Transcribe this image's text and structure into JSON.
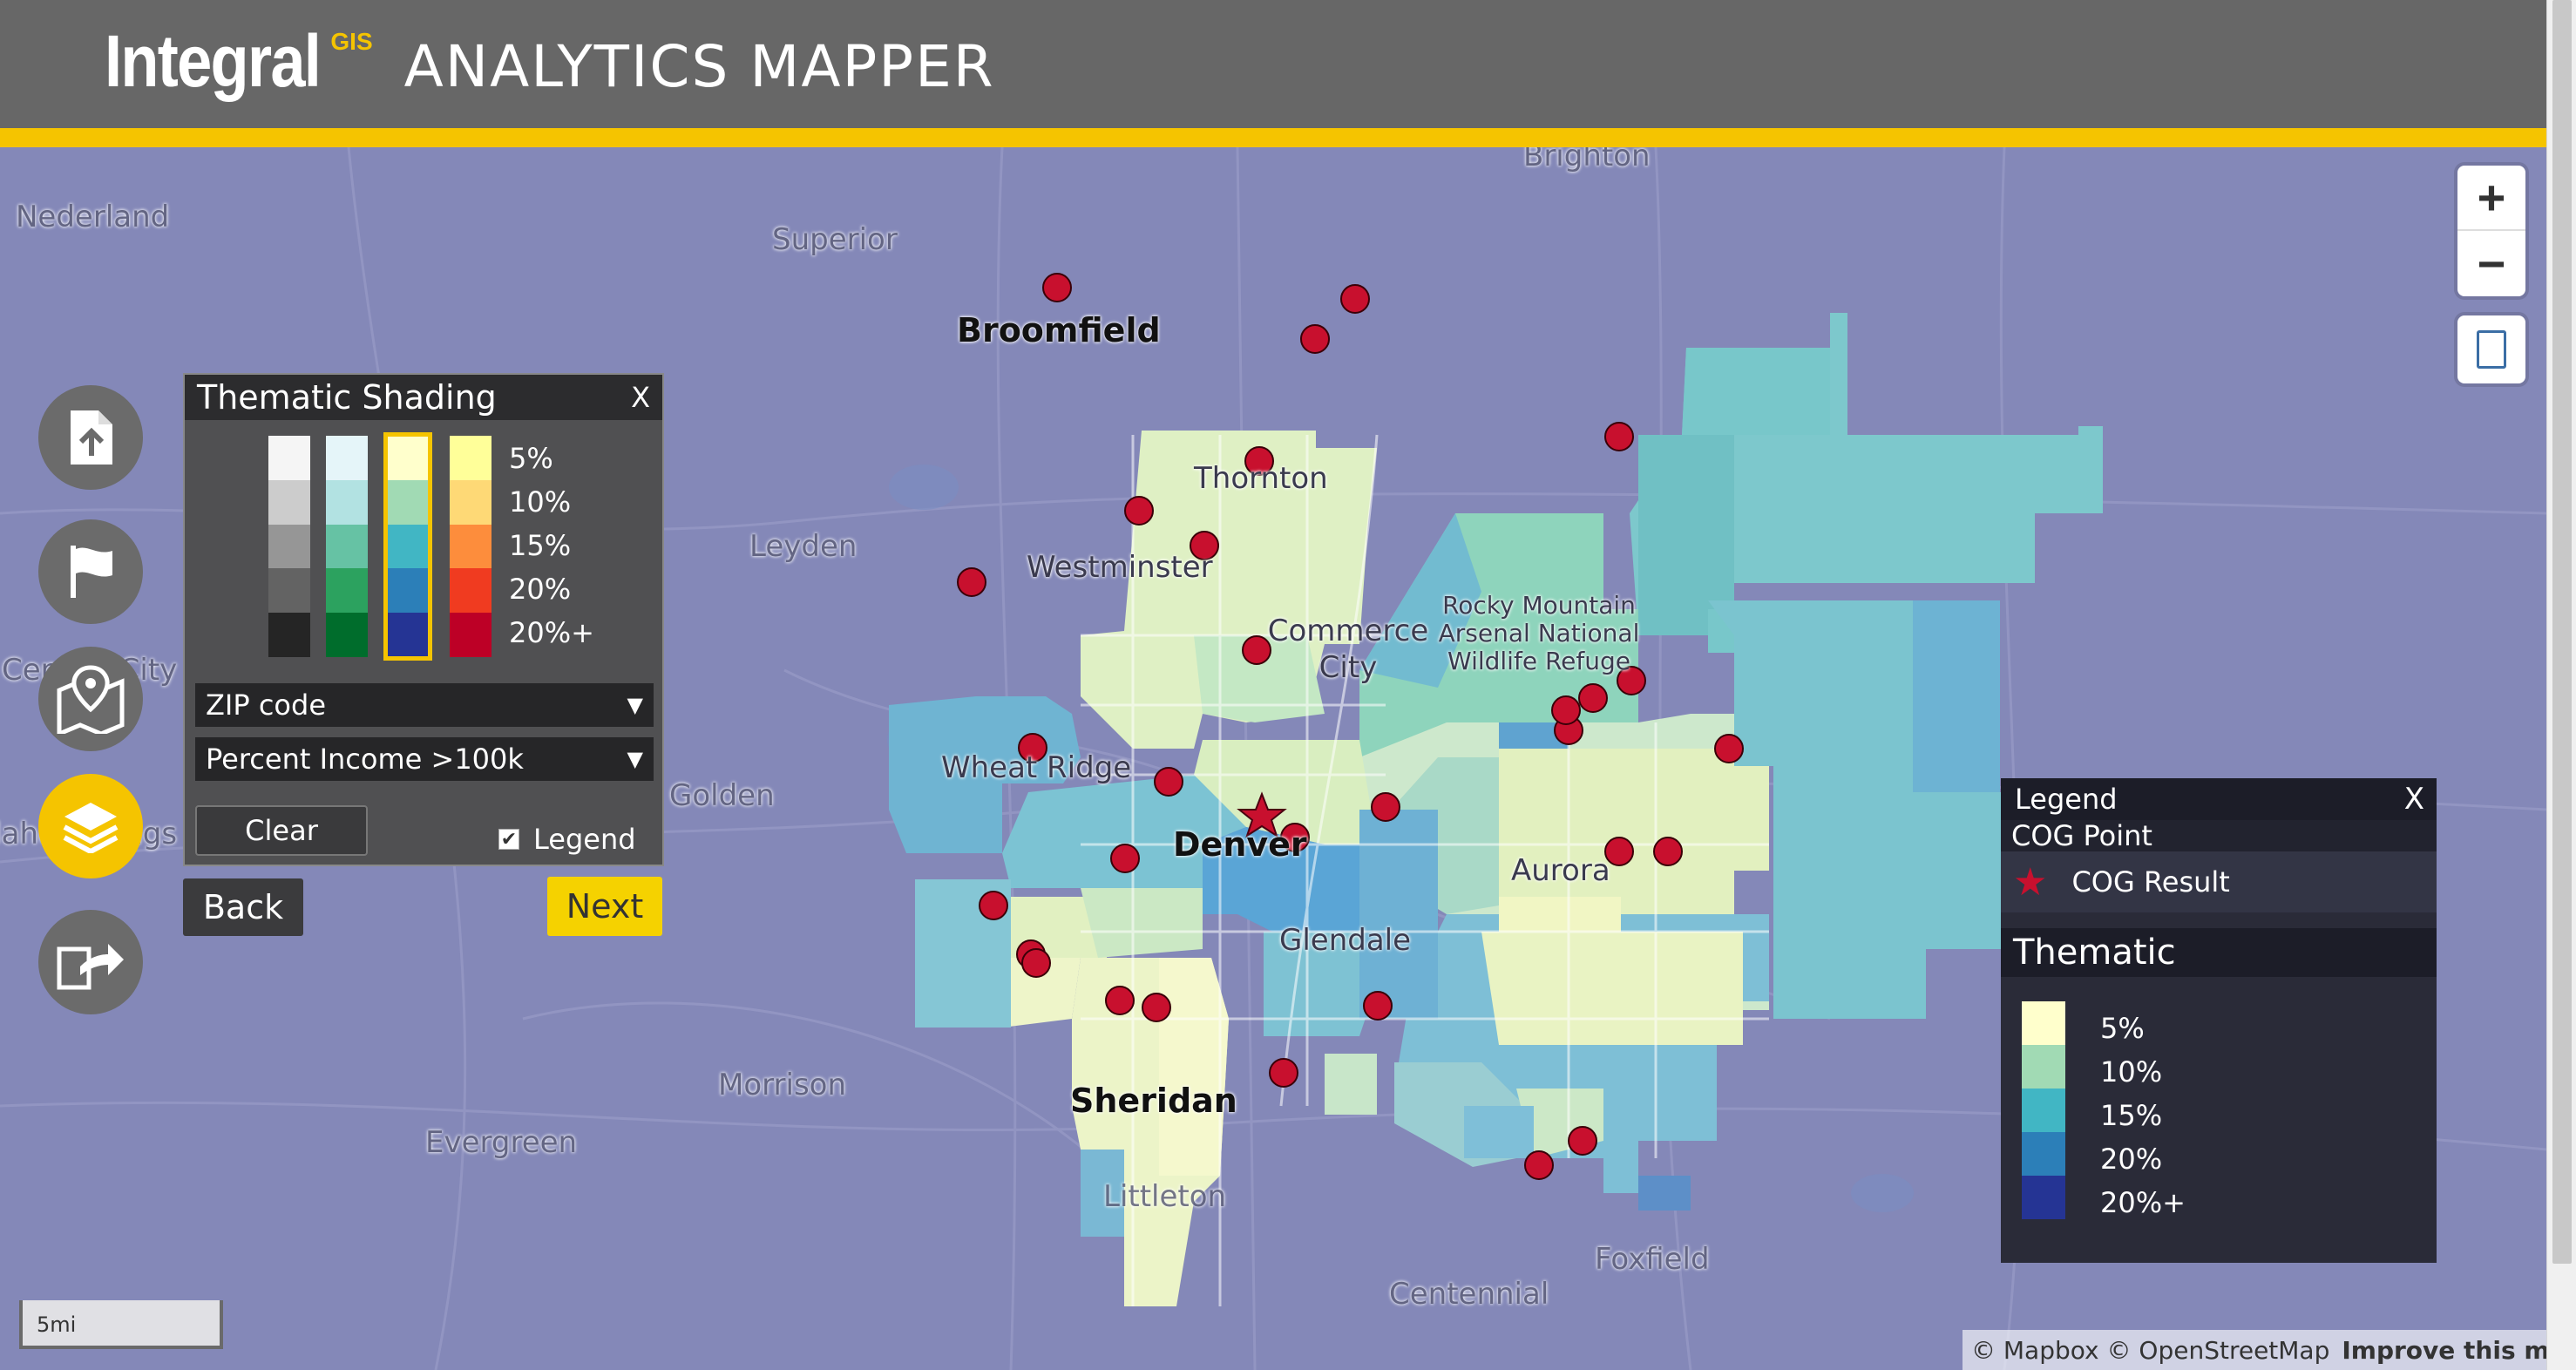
{
  "header": {
    "brand": "Integral",
    "brand_sup": "GIS",
    "product": "ANALYTICS MAPPER"
  },
  "colors": {
    "header": "#676767",
    "accent": "#f5c400",
    "map_bg": "#8488b8",
    "marker": "#c8102e"
  },
  "map": {
    "zoom_in_label": "+",
    "zoom_out_label": "−",
    "places": [
      {
        "name": "Brighton",
        "style": "muted"
      },
      {
        "name": "Nederland",
        "style": "muted"
      },
      {
        "name": "Superior",
        "style": "muted"
      },
      {
        "name": "Broomfield",
        "style": "bold"
      },
      {
        "name": "Thornton",
        "style": "normal"
      },
      {
        "name": "Westminster",
        "style": "normal"
      },
      {
        "name": "Leyden",
        "style": "muted"
      },
      {
        "name": "Commerce City",
        "style": "normal"
      },
      {
        "name": "Rocky Mountain Arsenal National Wildlife Refuge",
        "style": "normal"
      },
      {
        "name": "Central City",
        "style": "muted"
      },
      {
        "name": "Wheat Ridge",
        "style": "normal"
      },
      {
        "name": "Golden",
        "style": "muted"
      },
      {
        "name": "Denver",
        "style": "bold"
      },
      {
        "name": "Aurora",
        "style": "normal"
      },
      {
        "name": "Glendale",
        "style": "normal"
      },
      {
        "name": "Idaho Springs",
        "style": "muted"
      },
      {
        "name": "Morrison",
        "style": "muted"
      },
      {
        "name": "Sheridan",
        "style": "bold"
      },
      {
        "name": "Evergreen",
        "style": "muted"
      },
      {
        "name": "Littleton",
        "style": "muted"
      },
      {
        "name": "Foxfield",
        "style": "muted"
      },
      {
        "name": "Centennial",
        "style": "muted"
      }
    ],
    "scale_label": "5mi",
    "attribution": "© Mapbox © OpenStreetMap",
    "improve_link": "Improve this map"
  },
  "toolbar": {
    "icons": [
      "upload-icon",
      "flag-icon",
      "map-pin-icon",
      "layers-icon",
      "export-icon"
    ],
    "active": "layers-icon"
  },
  "thematic_panel": {
    "title": "Thematic Shading",
    "close": "X",
    "ramp_labels": [
      "5%",
      "10%",
      "15%",
      "20%",
      "20%+"
    ],
    "ramps": [
      [
        "#f5f5f5",
        "#cccccc",
        "#969696",
        "#636363",
        "#252525"
      ],
      [
        "#e5f5f9",
        "#b2e2e2",
        "#66c2a4",
        "#2ca25f",
        "#006d2c"
      ],
      [
        "#ffffcc",
        "#a1dab4",
        "#41b6c4",
        "#2c7fb8",
        "#253494"
      ],
      [
        "#ffff99",
        "#fed976",
        "#fd8d3c",
        "#f03b20",
        "#bd0026"
      ]
    ],
    "selected_ramp": 2,
    "geography_select": "ZIP code",
    "variable_select": "Percent Income >100k",
    "clear_label": "Clear",
    "legend_checkbox_label": "Legend",
    "legend_checked": true,
    "back_label": "Back",
    "next_label": "Next"
  },
  "legend": {
    "title": "Legend",
    "close": "X",
    "point_section": "COG Point",
    "point_item": "COG Result",
    "thematic_section": "Thematic",
    "thematic_labels": [
      "5%",
      "10%",
      "15%",
      "20%",
      "20%+"
    ],
    "thematic_colors": [
      "#ffffcc",
      "#a1dab4",
      "#41b6c4",
      "#2c7fb8",
      "#253494"
    ]
  }
}
